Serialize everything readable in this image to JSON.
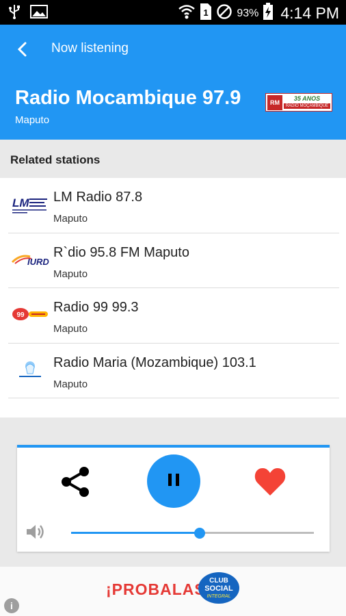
{
  "status_bar": {
    "battery_percent": "93%",
    "time": "4:14 PM",
    "icons": [
      "usb-icon",
      "image-icon",
      "wifi-icon",
      "sim-icon",
      "blocked-icon",
      "battery-charging-icon"
    ]
  },
  "header": {
    "nav_title": "Now listening",
    "station_name": "Radio Mocambique 97.9",
    "station_city": "Maputo",
    "logo": {
      "badge": "RM",
      "anos": "35 ANOS",
      "subtitle": "RÁDIO MOÇAMBIQUE"
    },
    "color": "#2196f3"
  },
  "related": {
    "title": "Related stations",
    "items": [
      {
        "name": "LM Radio 87.8",
        "city": "Maputo",
        "logo": "lm-radio-logo"
      },
      {
        "name": "R`dio 95.8 FM Maputo",
        "city": "Maputo",
        "logo": "iurd-logo"
      },
      {
        "name": "Radio 99 99.3",
        "city": "Maputo",
        "logo": "radio-99-logo"
      },
      {
        "name": "Radio Maria (Mozambique) 103.1",
        "city": "Maputo",
        "logo": "radio-maria-logo"
      }
    ]
  },
  "player": {
    "volume_level": 0.53,
    "state": "playing",
    "favorite_color": "#f44336"
  },
  "ad": {
    "text": "¡PROBALAS!",
    "logo_lines": [
      "CLUB",
      "SOCIAL",
      "INTEGRAL"
    ],
    "info_label": "i"
  }
}
